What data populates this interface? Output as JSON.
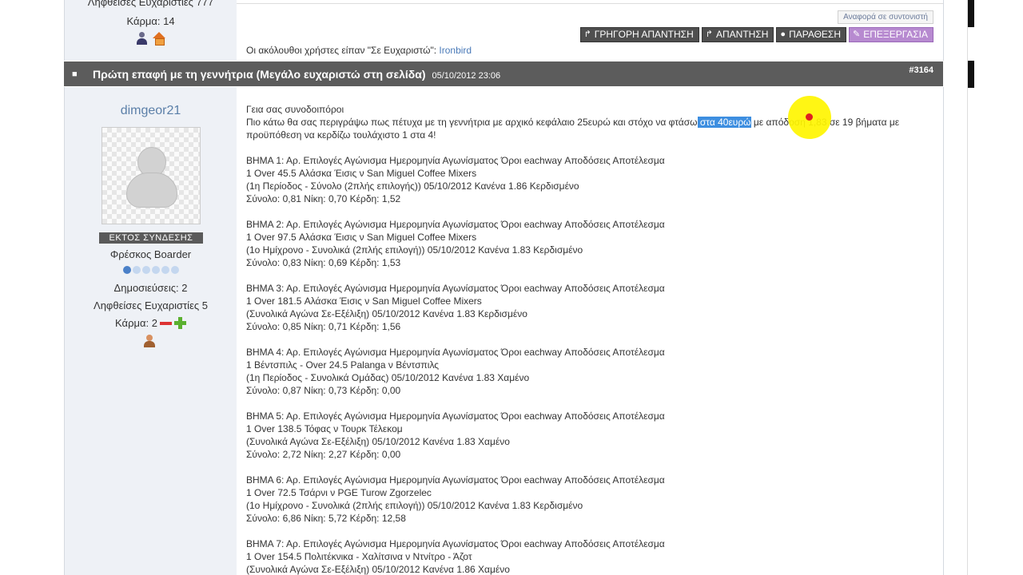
{
  "prev_post": {
    "thanks_count": "Ληφθείσες Ευχαριστίες 777",
    "karma": "Κάρμα: 14",
    "report_label": "Αναφορά σε συντονιστή",
    "actions": {
      "quick_reply": "ΓΡΗΓΟΡΗ ΑΠΑΝΤΗΣΗ",
      "reply": "ΑΠΑΝΤΗΣΗ",
      "quote": "ΠΑΡΑΘΕΣΗ",
      "edit": "ΕΠΕΞΕΡΓΑΣΙΑ"
    },
    "thanks_text": "Οι ακόλουθοι χρήστες είπαν \"Σε Ευχαριστώ\":",
    "thanks_user": "Ironbird"
  },
  "post": {
    "title": "Πρώτη επαφή με τη γεννήτρια (Μεγάλο ευχαριστώ στη σελίδα)",
    "date": "05/10/2012 23:06",
    "number": "#3164"
  },
  "author": {
    "username": "dimgeor21",
    "status": "ΕΚΤΟΣ ΣΥΝΔΕΣΗΣ",
    "rank": "Φρέσκος Boarder",
    "rank_level": 1,
    "rank_max": 6,
    "posts": "Δημοσιεύσεις: 2",
    "thanks": "Ληφθείσες Ευχαριστίες 5",
    "karma": "Κάρμα: 2"
  },
  "body": {
    "greeting": "Γεια σας συνοδοιπόροι",
    "intro_before": "Πιο κάτω θα σας περιγράψω πως πέτυχα με τη γεννήτρια με αρχικό κεφάλαιο 25ευρώ και στόχο να φτάσω",
    "intro_highlight": " στα 40ευρώ",
    "intro_after": " με απόδοση 1,83 σε 19 βήματα με προϋπόθεση να κερδίζω τουλάχιστο 1 στα 4!",
    "steps": [
      {
        "header": "ΒΗΜΑ 1: Αρ. Επιλογές Αγώνισμα Ημερομηνία Αγωνίσματος Όροι eachway Αποδόσεις Αποτέλεσμα",
        "line1": "1 Over 45.5 Αλάσκα Έισις ν San Miguel Coffee Mixers",
        "line2": "(1η Περίοδος - Σύνολο (2πλής επιλογής)) 05/10/2012 Κανένα 1.86 Κερδισμένο",
        "line3": "Σύνολο: 0,81 Νίκη: 0,70 Κέρδη: 1,52"
      },
      {
        "header": "ΒΗΜΑ 2: Αρ. Επιλογές Αγώνισμα Ημερομηνία Αγωνίσματος Όροι eachway Αποδόσεις Αποτέλεσμα",
        "line1": "1 Over 97.5 Αλάσκα Έισις ν San Miguel Coffee Mixers",
        "line2": "(1ο Ημίχρονο - Συνολικά (2πλής επιλογή)) 05/10/2012 Κανένα 1.83 Κερδισμένο",
        "line3": "Σύνολο: 0,83 Νίκη: 0,69 Κέρδη: 1,53"
      },
      {
        "header": "ΒΗΜΑ 3: Αρ. Επιλογές Αγώνισμα Ημερομηνία Αγωνίσματος Όροι eachway Αποδόσεις Αποτέλεσμα",
        "line1": "1 Over 181.5 Αλάσκα Έισις ν San Miguel Coffee Mixers",
        "line2": "(Συνολικά Αγώνα Σε-Εξέλιξη) 05/10/2012 Κανένα 1.83 Κερδισμένο",
        "line3": "Σύνολο: 0,85 Νίκη: 0,71 Κέρδη: 1,56"
      },
      {
        "header": "ΒΗΜΑ 4: Αρ. Επιλογές Αγώνισμα Ημερομηνία Αγωνίσματος Όροι eachway Αποδόσεις Αποτέλεσμα",
        "line1": "1 Βέντσπιλς - Over 24.5 Palanga ν Βέντσπιλς",
        "line2": "(1η Περίοδος - Συνολικά Ομάδας) 05/10/2012 Κανένα 1.83 Χαμένο",
        "line3": "Σύνολο: 0,87 Νίκη: 0,73 Κέρδη: 0,00"
      },
      {
        "header": "ΒΗΜΑ 5: Αρ. Επιλογές Αγώνισμα Ημερομηνία Αγωνίσματος Όροι eachway Αποδόσεις Αποτέλεσμα",
        "line1": "1 Over 138.5 Τόφας ν Τουρκ Τέλεκομ",
        "line2": "(Συνολικά Αγώνα Σε-Εξέλιξη) 05/10/2012 Κανένα 1.83 Χαμένο",
        "line3": "Σύνολο: 2,72 Νίκη: 2,27 Κέρδη: 0,00"
      },
      {
        "header": "ΒΗΜΑ 6: Αρ. Επιλογές Αγώνισμα Ημερομηνία Αγωνίσματος Όροι eachway Αποδόσεις Αποτέλεσμα",
        "line1": "1 Over 72.5 Τσάρνι ν PGE Turow Zgorzelec",
        "line2": "(1ο Ημίχρονο - Συνολικά (2πλής επιλογή)) 05/10/2012 Κανένα 1.83 Κερδισμένο",
        "line3": "Σύνολο: 6,86 Νίκη: 5,72 Κέρδη: 12,58"
      },
      {
        "header": "ΒΗΜΑ 7: Αρ. Επιλογές Αγώνισμα Ημερομηνία Αγωνίσματος Όροι eachway Αποδόσεις Αποτέλεσμα",
        "line1": "1 Over 154.5 Πολιτέκνικα - Χαλίτσινα ν Ντνίτρο - Άζοτ",
        "line2": "(Συνολικά Αγώνα Σε-Εξέλιξη) 05/10/2012 Κανένα 1.86 Χαμένο",
        "line3": ""
      }
    ]
  },
  "colors": {
    "header_bar": "#5c5c5c",
    "link": "#5b7fa8",
    "highlight": "#3d8ee0",
    "edit_button": "#b78ad0"
  }
}
